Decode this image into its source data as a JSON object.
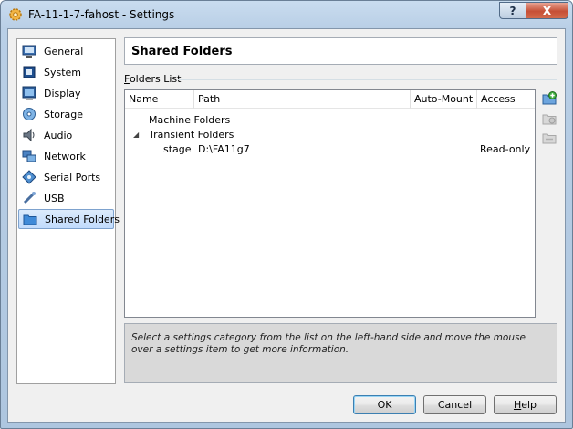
{
  "window": {
    "title": "FA-11-1-7-fahost - Settings",
    "title_icon": "gear-icon",
    "help_glyph": "?",
    "close_glyph": "X"
  },
  "sidebar": {
    "items": [
      {
        "label": "General",
        "icon": "monitor-icon"
      },
      {
        "label": "System",
        "icon": "chip-icon"
      },
      {
        "label": "Display",
        "icon": "display-icon"
      },
      {
        "label": "Storage",
        "icon": "disk-icon"
      },
      {
        "label": "Audio",
        "icon": "speaker-icon"
      },
      {
        "label": "Network",
        "icon": "network-icon"
      },
      {
        "label": "Serial Ports",
        "icon": "serial-port-icon"
      },
      {
        "label": "USB",
        "icon": "usb-icon"
      },
      {
        "label": "Shared Folders",
        "icon": "folder-icon",
        "selected": true
      }
    ]
  },
  "header": {
    "title": "Shared Folders"
  },
  "folders_list": {
    "label": "Folders List",
    "columns": [
      "Name",
      "Path",
      "Auto-Mount",
      "Access"
    ],
    "groups": [
      {
        "name": "Machine Folders",
        "children": []
      },
      {
        "name": "Transient Folders",
        "expanded": true,
        "children": [
          {
            "name": "stage",
            "path": "D:\\FA11g7",
            "auto_mount": "",
            "access": "Read-only"
          }
        ]
      }
    ],
    "actions": [
      {
        "name": "add-shared-folder-button",
        "icon": "add-folder-icon",
        "enabled": true
      },
      {
        "name": "edit-shared-folder-button",
        "icon": "edit-folder-icon",
        "enabled": false
      },
      {
        "name": "remove-shared-folder-button",
        "icon": "remove-folder-icon",
        "enabled": false
      }
    ]
  },
  "info": {
    "text": "Select a settings category from the list on the left-hand side and move the mouse over a settings item to get more information."
  },
  "buttons": {
    "ok": "OK",
    "cancel": "Cancel",
    "help": "Help"
  },
  "colors": {
    "title_bar": "#b9cfe6",
    "selection": "#c1dbfc",
    "close_button": "#c64f36"
  }
}
